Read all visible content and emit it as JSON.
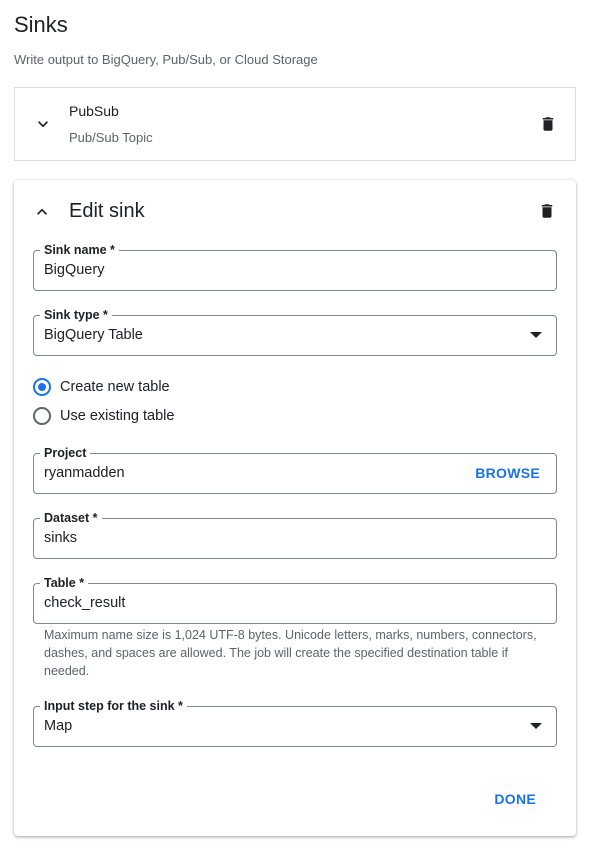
{
  "header": {
    "title": "Sinks",
    "subtitle": "Write output to BigQuery, Pub/Sub, or Cloud Storage"
  },
  "collapsed_sink": {
    "name": "PubSub",
    "type": "Pub/Sub Topic"
  },
  "edit_sink": {
    "heading": "Edit sink",
    "sink_name": {
      "label": "Sink name *",
      "value": "BigQuery"
    },
    "sink_type": {
      "label": "Sink type *",
      "value": "BigQuery Table"
    },
    "table_mode": {
      "options": [
        {
          "label": "Create new table",
          "selected": true
        },
        {
          "label": "Use existing table",
          "selected": false
        }
      ]
    },
    "project": {
      "label": "Project",
      "value": "ryanmadden",
      "browse_label": "BROWSE"
    },
    "dataset": {
      "label": "Dataset *",
      "value": "sinks"
    },
    "table": {
      "label": "Table *",
      "value": "check_result",
      "hint": "Maximum name size is 1,024 UTF-8 bytes. Unicode letters, marks, numbers, connectors, dashes, and spaces are allowed. The job will create the specified destination table if needed."
    },
    "input_step": {
      "label": "Input step for the sink *",
      "value": "Map"
    },
    "done_label": "DONE"
  },
  "colors": {
    "accent": "#1a73e8",
    "text": "#202124",
    "secondary_text": "#5f6368",
    "border": "#80868b"
  }
}
